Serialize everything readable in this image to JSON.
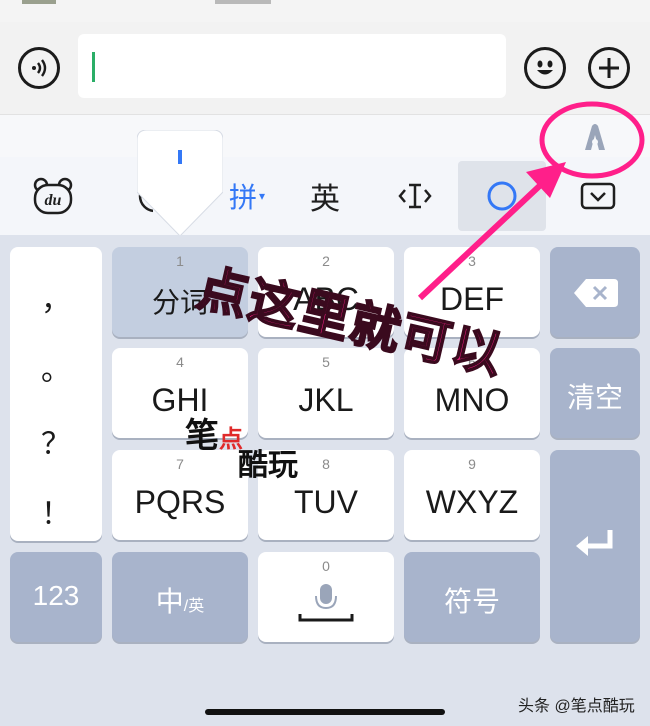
{
  "input_bar": {
    "voice_icon": "voice-icon",
    "text_value": "",
    "emoji_icon": "emoji-icon",
    "add_icon": "plus-icon"
  },
  "suggest_bar": {
    "icon": "assistant-a-icon"
  },
  "toolbar": {
    "items": [
      {
        "name": "du-logo",
        "label": "du"
      },
      {
        "name": "pinyin-mode",
        "label": "拼"
      },
      {
        "name": "english-mode",
        "label": "英"
      },
      {
        "name": "cursor-move",
        "label": ""
      },
      {
        "name": "circle-tool",
        "label": ""
      },
      {
        "name": "collapse-keyboard",
        "label": ""
      }
    ]
  },
  "keyboard": {
    "punct_column": [
      "，",
      "。",
      "？",
      "！"
    ],
    "keys": [
      {
        "num": "1",
        "label": "分词"
      },
      {
        "num": "2",
        "label": "ABC"
      },
      {
        "num": "3",
        "label": "DEF"
      },
      {
        "num": "4",
        "label": "GHI"
      },
      {
        "num": "5",
        "label": "JKL"
      },
      {
        "num": "6",
        "label": "MNO"
      },
      {
        "num": "7",
        "label": "PQRS"
      },
      {
        "num": "8",
        "label": "TUV"
      },
      {
        "num": "9",
        "label": "WXYZ"
      },
      {
        "num": "0",
        "label": ""
      }
    ],
    "clear_label": "清空",
    "num_label": "123",
    "lang_label_main": "中",
    "lang_label_sub": "/英",
    "symbol_label": "符号"
  },
  "annotation": {
    "text": "点这里就可以"
  },
  "watermark": {
    "line1": "笔",
    "dot": "点",
    "line2": "酷玩"
  },
  "credit": {
    "text": "头条 @笔点酷玩"
  },
  "colors": {
    "annotation": "#ff1f8a",
    "caret": "#2aae67",
    "accent_blue": "#3478f6"
  }
}
